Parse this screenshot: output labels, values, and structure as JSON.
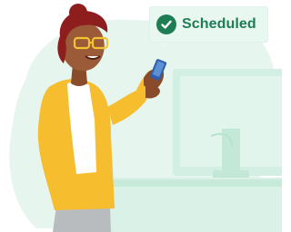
{
  "status_bubble": {
    "label": "Scheduled",
    "icon": "check-circle-icon",
    "accent_color": "#1d7d53",
    "background_color": "#e8f7f0"
  },
  "illustration": {
    "person": "woman-with-glasses-holding-phone",
    "device": "desktop-monitor",
    "background_blob_color": "#e6f5ee",
    "jacket_color": "#f6bd2f",
    "hair_color": "#8e1d1d",
    "glasses_color": "#f1c531"
  }
}
